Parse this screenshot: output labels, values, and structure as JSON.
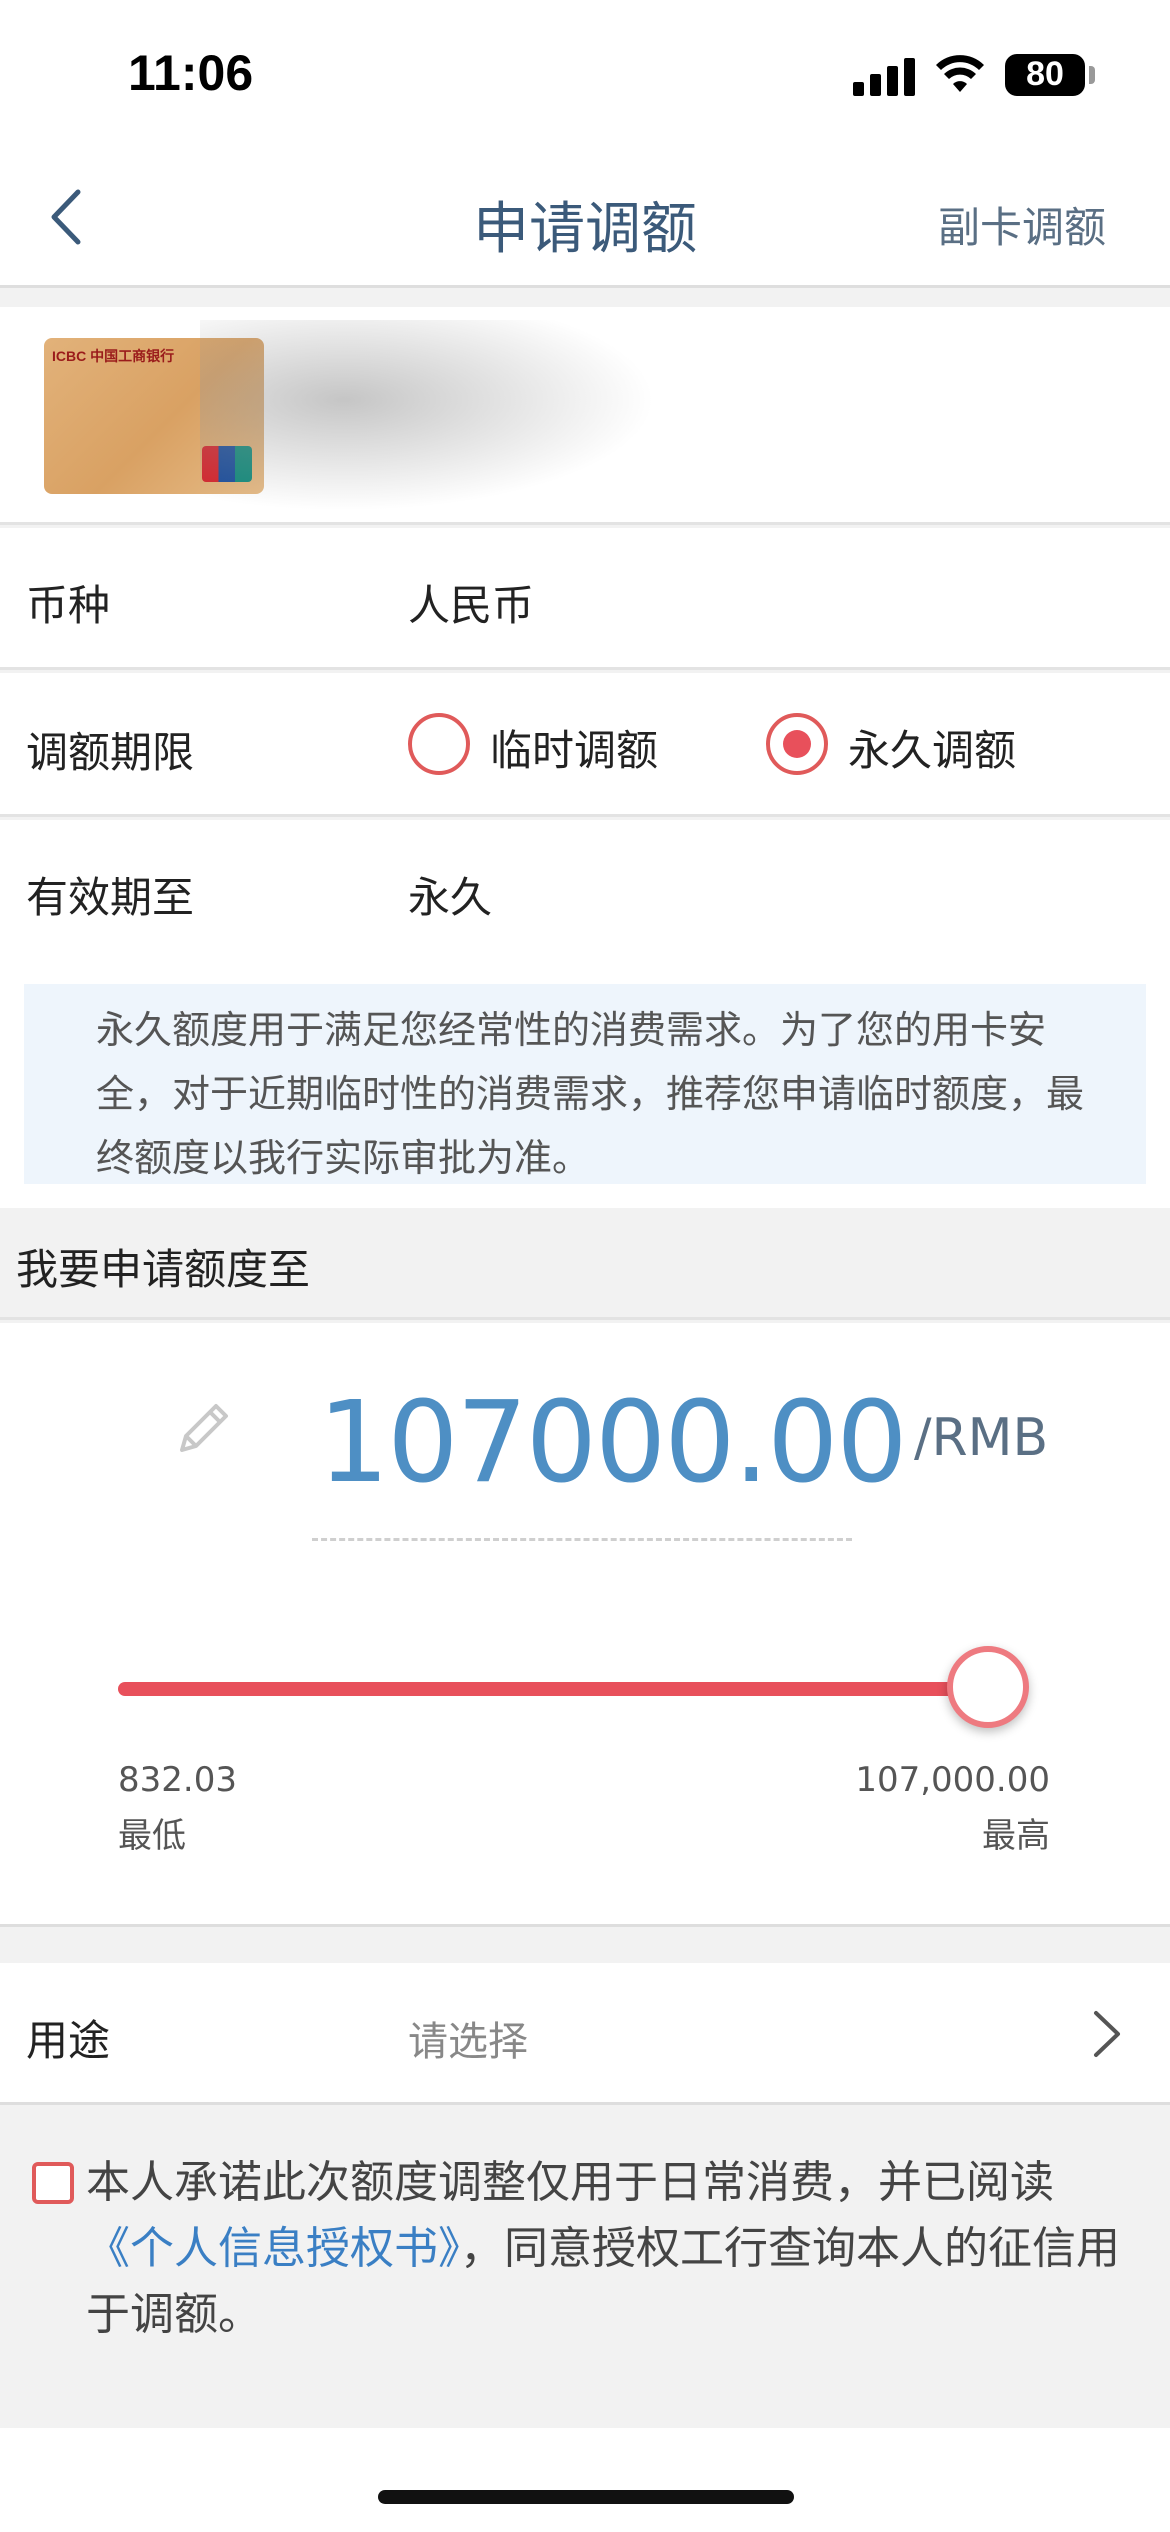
{
  "status_bar": {
    "time": "11:06",
    "battery": "80"
  },
  "nav": {
    "title": "申请调额",
    "right_action": "副卡调额"
  },
  "card": {
    "bank_mark": "ICBC 中国工商银行"
  },
  "form": {
    "currency_label": "币种",
    "currency_value": "人民币",
    "period_label": "调额期限",
    "period_options": [
      {
        "label": "临时调额",
        "checked": false
      },
      {
        "label": "永久调额",
        "checked": true
      }
    ],
    "valid_until_label": "有效期至",
    "valid_until_value": "永久"
  },
  "info_text": "永久额度用于满足您经常性的消费需求。为了您的用卡安全，对于近期临时性的消费需求，推荐您申请临时额度，最终额度以我行实际审批为准。",
  "amount": {
    "section_title": "我要申请额度至",
    "value": "107000.00",
    "unit": "/RMB",
    "slider_fraction": 1.0,
    "min_value": "832.03",
    "min_label": "最低",
    "max_value": "107,000.00",
    "max_label": "最高"
  },
  "purpose": {
    "label": "用途",
    "placeholder": "请选择"
  },
  "agreement": {
    "checked": false,
    "text_before": "本人承诺此次额度调整仅用于日常消费，并已阅读",
    "link": "《个人信息授权书》",
    "text_after": "，同意授权工行查询本人的征信用于调额。"
  },
  "colors": {
    "accent_red": "#e8505b",
    "amount_blue": "#4e8fc4",
    "link_blue": "#3a7fc4",
    "nav_title": "#3b5a7a"
  },
  "icons": [
    "back-chevron-icon",
    "pencil-icon",
    "chevron-right-icon",
    "signal-icon",
    "wifi-icon",
    "battery-icon"
  ]
}
